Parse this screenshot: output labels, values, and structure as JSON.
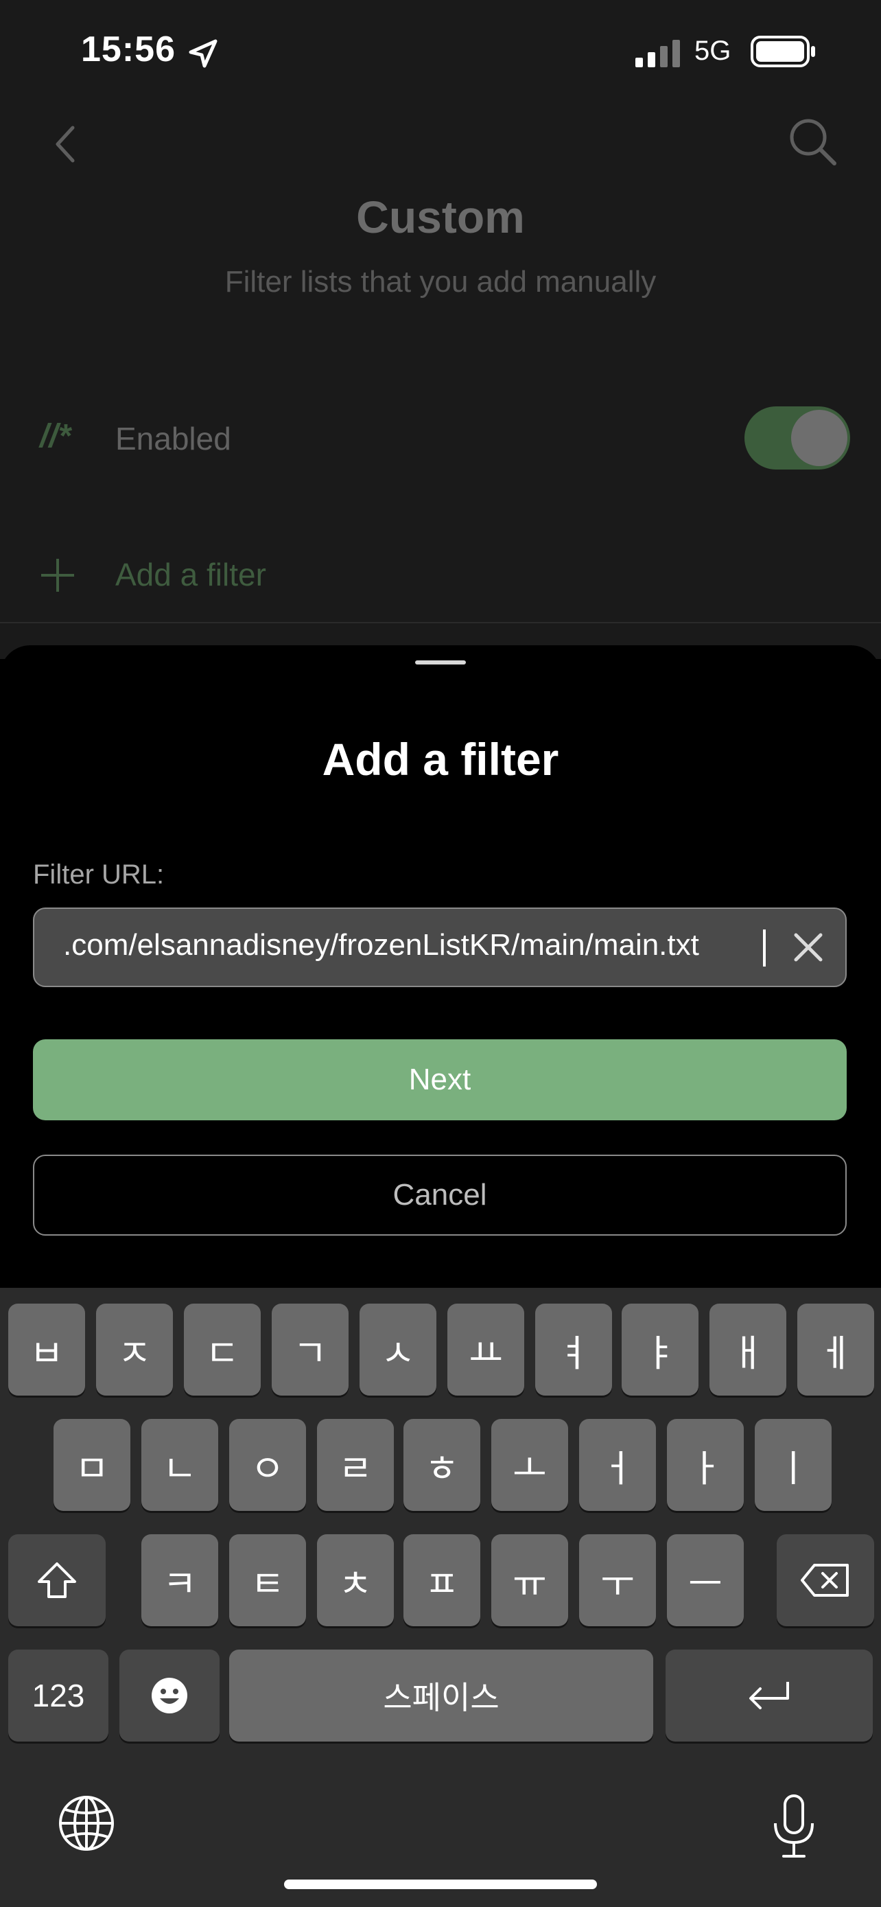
{
  "status_bar": {
    "time": "15:56",
    "network": "5G"
  },
  "header": {
    "title": "Custom",
    "subtitle": "Filter lists that you add manually"
  },
  "rows": {
    "filter_glyph": "//*",
    "enabled_label": "Enabled",
    "enabled_on": true,
    "add_label": "Add a filter"
  },
  "sheet": {
    "title": "Add a filter",
    "url_label": "Filter URL:",
    "url_value": ".com/elsannadisney/frozenListKR/main/main.txt",
    "next_label": "Next",
    "cancel_label": "Cancel"
  },
  "keyboard": {
    "row1": [
      "ㅂ",
      "ㅈ",
      "ㄷ",
      "ㄱ",
      "ㅅ",
      "ㅛ",
      "ㅕ",
      "ㅑ",
      "ㅐ",
      "ㅔ"
    ],
    "row2": [
      "ㅁ",
      "ㄴ",
      "ㅇ",
      "ㄹ",
      "ㅎ",
      "ㅗ",
      "ㅓ",
      "ㅏ",
      "ㅣ"
    ],
    "row3": [
      "ㅋ",
      "ㅌ",
      "ㅊ",
      "ㅍ",
      "ㅠ",
      "ㅜ",
      "ㅡ"
    ],
    "numbers_label": "123",
    "space_label": "스페이스"
  },
  "colors": {
    "accent": "#7ab07e",
    "background": "#000000",
    "keyboard": "#2b2b2b"
  }
}
